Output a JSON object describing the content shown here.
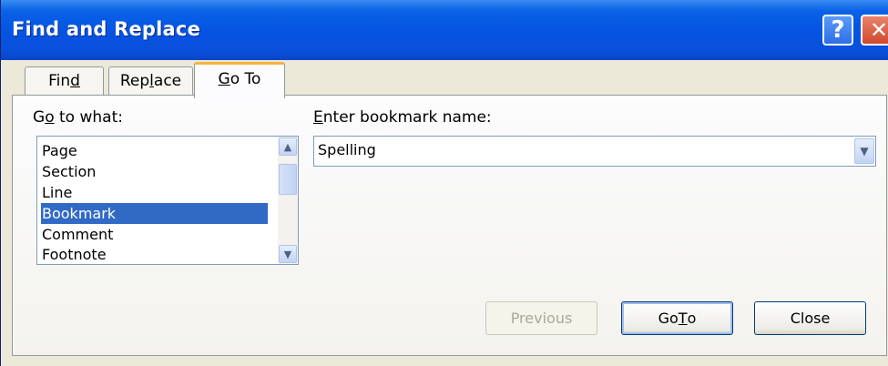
{
  "window": {
    "title": "Find and Replace",
    "help_glyph": "?",
    "close_glyph": "✕"
  },
  "tabs": [
    {
      "label_pre": "Fin",
      "label_ul": "d",
      "label_post": "",
      "active": false
    },
    {
      "label_pre": "Rep",
      "label_ul": "l",
      "label_post": "ace",
      "active": false
    },
    {
      "label_pre": "",
      "label_ul": "G",
      "label_post": "o To",
      "active": true
    }
  ],
  "go_to_what": {
    "label_pre": "G",
    "label_ul": "o",
    "label_post": " to what:",
    "items": [
      "Page",
      "Section",
      "Line",
      "Bookmark",
      "Comment",
      "Footnote"
    ],
    "selected": "Bookmark"
  },
  "bookmark": {
    "label_ul": "E",
    "label_post": "nter bookmark name:",
    "value": "Spelling"
  },
  "buttons": {
    "previous": "Previous",
    "goto_pre": "Go ",
    "goto_ul": "T",
    "goto_post": "o",
    "close": "Close"
  },
  "icons": {
    "scroll_up": "up-arrow-icon",
    "scroll_down": "down-arrow-icon",
    "dropdown": "chevron-down-icon"
  }
}
